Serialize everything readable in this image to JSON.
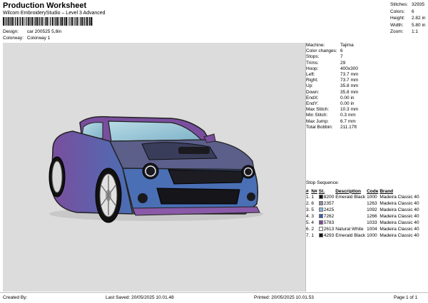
{
  "header": {
    "title": "Production Worksheet",
    "subtitle": "Wilcom EmbroideryStudio – Level 3 Advanced",
    "barcode_suffix": "1",
    "design_label": "Design:",
    "design_value": "car 200525 5,8in",
    "colorway_label": "Colorway:",
    "colorway_value": "Colorway 1"
  },
  "stats": [
    {
      "label": "Stitches:",
      "value": "32935"
    },
    {
      "label": "Colors:",
      "value": "6"
    },
    {
      "label": "Height:",
      "value": "2.82 in"
    },
    {
      "label": "Width:",
      "value": "5.80 in"
    },
    {
      "label": "Zoom:",
      "value": "1:1"
    }
  ],
  "machine_info": [
    {
      "label": "Machine:",
      "value": "Tajima"
    },
    {
      "label": "Color changes:",
      "value": "6"
    },
    {
      "label": "Stops:",
      "value": "7"
    },
    {
      "label": "Trims:",
      "value": "29"
    },
    {
      "label": "Hoop:",
      "value": "400x300"
    },
    {
      "label": "Left:",
      "value": "73.7 mm"
    },
    {
      "label": "Right:",
      "value": "73.7 mm"
    },
    {
      "label": "Up:",
      "value": "35.8 mm"
    },
    {
      "label": "Down:",
      "value": "35.8 mm"
    },
    {
      "label": "EndX:",
      "value": "0.00 in"
    },
    {
      "label": "EndY:",
      "value": "0.00 in"
    },
    {
      "label": "Max Stitch:",
      "value": "10.3 mm"
    },
    {
      "label": "Min Stitch:",
      "value": "0.3 mm"
    },
    {
      "label": "Max Jump:",
      "value": "6.7 mm"
    },
    {
      "label": "Total Bobbin:",
      "value": "211.17ft"
    }
  ],
  "sequence": {
    "title": "Stop Sequence:",
    "headers": [
      "#",
      "N#",
      "St.",
      "Description",
      "Code",
      "Brand"
    ],
    "rows": [
      {
        "num": "1.",
        "n": "1",
        "color": "#111111",
        "st": "8200",
        "desc": "Emerald Black",
        "code": "1000",
        "brand": "Madeira Classic 40"
      },
      {
        "num": "2.",
        "n": "6",
        "color": "#8a8fa0",
        "st": "2357",
        "desc": "",
        "code": "1263",
        "brand": "Madeira Classic 40"
      },
      {
        "num": "3.",
        "n": "5",
        "color": "#86b7d6",
        "st": "2425",
        "desc": "",
        "code": "1092",
        "brand": "Madeira Classic 40"
      },
      {
        "num": "4.",
        "n": "3",
        "color": "#3a5ea8",
        "st": "7262",
        "desc": "",
        "code": "1266",
        "brand": "Madeira Classic 40"
      },
      {
        "num": "5.",
        "n": "4",
        "color": "#7a4a9c",
        "st": "5783",
        "desc": "",
        "code": "1033",
        "brand": "Madeira Classic 40"
      },
      {
        "num": "6.",
        "n": "2",
        "color": "#f4f4f4",
        "st": "2613",
        "desc": "Natural White",
        "code": "1004",
        "brand": "Madeira Classic 40"
      },
      {
        "num": "7.",
        "n": "1",
        "color": "#111111",
        "st": "4293",
        "desc": "Emerald Black",
        "code": "1000",
        "brand": "Madeira Classic 40"
      }
    ]
  },
  "footer": {
    "created_by": "Created By:",
    "last_saved": "Last Saved: 20/05/2025 10.01.48",
    "printed": "Printed: 20/05/2025 10.01.53",
    "page": "Page 1 of 1"
  },
  "colors": {
    "canvas_bg": "#dcdcdc",
    "car_body_blue": "#4a6fb0",
    "car_body_purple": "#7b4f9e",
    "windshield": "#9fc9d8"
  }
}
